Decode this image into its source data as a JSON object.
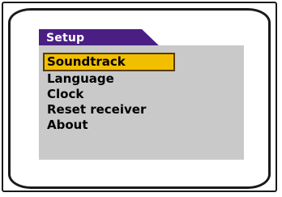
{
  "screen": {
    "title": "Setup",
    "items": [
      {
        "label": "Soundtrack",
        "selected": true
      },
      {
        "label": "Language",
        "selected": false
      },
      {
        "label": "Clock",
        "selected": false
      },
      {
        "label": "Reset receiver",
        "selected": false
      },
      {
        "label": "About",
        "selected": false
      }
    ]
  },
  "colors": {
    "title_bar": "#4b1e84",
    "panel": "#c9c9c9",
    "highlight": "#f2bf00"
  }
}
